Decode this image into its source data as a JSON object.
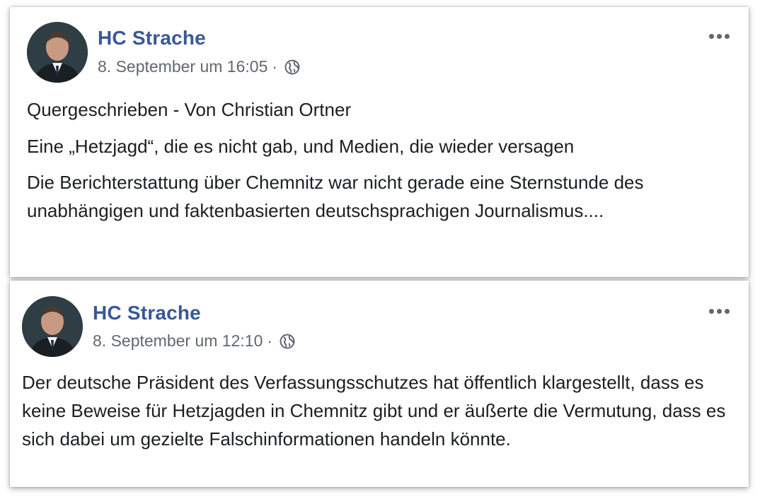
{
  "posts": [
    {
      "author": "HC Strache",
      "date": "8. September um 16:05",
      "separator": "·",
      "privacy_icon": "globe-icon",
      "lines": [
        "Quergeschrieben - Von Christian Ortner",
        "Eine „Hetzjagd“, die es nicht gab, und Medien, die wieder versagen",
        "Die Berichterstattung über Chemnitz war nicht gerade eine Sternstunde des unabhängigen und faktenbasierten deutschsprachigen Journalismus...."
      ]
    },
    {
      "author": "HC Strache",
      "date": "8. September um 12:10",
      "separator": "·",
      "privacy_icon": "globe-icon",
      "lines": [
        "Der deutsche Präsident des Verfassungsschutzes hat öffentlich klargestellt, dass es keine Beweise für Hetzjagden in Chemnitz gibt und er äußerte die Vermutung, dass es sich dabei um gezielte Falschinformationen handeln könnte."
      ]
    }
  ],
  "colors": {
    "author": "#385898",
    "meta": "#616770",
    "text": "#1c1e21"
  },
  "icons": [
    "avatar",
    "globe-icon",
    "more-options-icon"
  ]
}
